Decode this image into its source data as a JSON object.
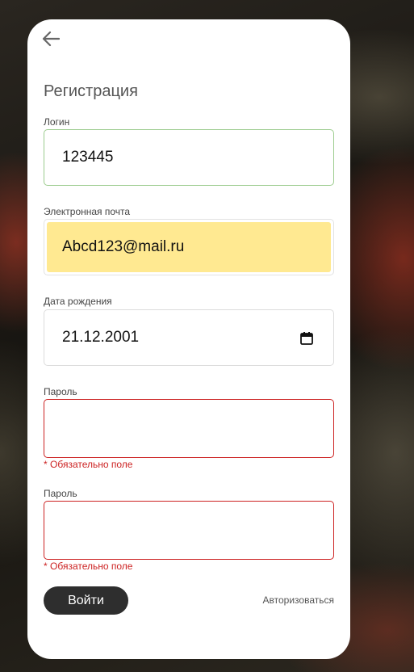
{
  "form": {
    "title": "Регистрация",
    "login": {
      "label": "Логин",
      "value": "123445"
    },
    "email": {
      "label": "Электронная почта",
      "value": "Abcd123@mail.ru"
    },
    "birthdate": {
      "label": "Дата рождения",
      "value": "21.12.2001"
    },
    "password": {
      "label": "Пароль",
      "value": "",
      "error": "* Обязательно поле"
    },
    "password_confirm": {
      "label": "Пароль",
      "value": "",
      "error": "* Обязательно поле"
    },
    "submit_label": "Войти",
    "login_link": "Авторизоваться"
  },
  "icons": {
    "back": "arrow-left-icon",
    "calendar": "calendar-icon"
  },
  "colors": {
    "card_bg": "#ffffff",
    "valid_border": "#9ccc8e",
    "error": "#cc2222",
    "autofill_bg": "#ffe991",
    "button_bg": "#2e2e2e"
  }
}
